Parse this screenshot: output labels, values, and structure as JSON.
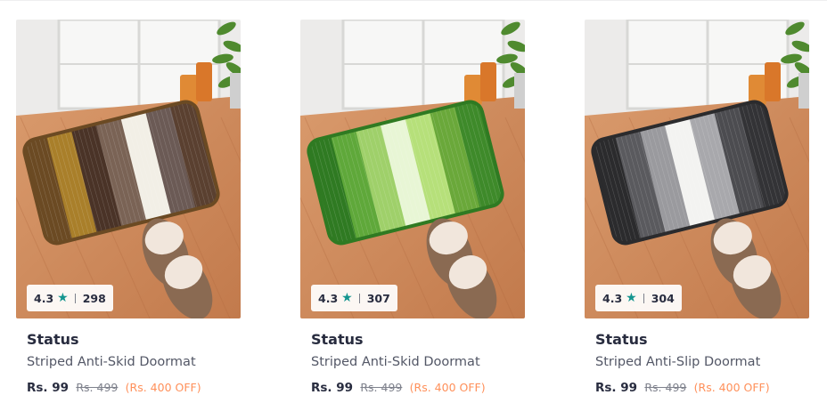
{
  "products": [
    {
      "brand": "Status",
      "name": "Striped Anti-Skid Doormat",
      "rating": "4.3",
      "reviews": "298",
      "price": "Rs. 99",
      "mrp": "Rs. 499",
      "discount": "(Rs. 400 OFF)",
      "mat_colors": [
        "#6b4a23",
        "#a97f2a",
        "#4a3327",
        "#7a6355",
        "#f2efe6",
        "#6b5a55",
        "#5a4030"
      ]
    },
    {
      "brand": "Status",
      "name": "Striped Anti-Skid Doormat",
      "rating": "4.3",
      "reviews": "307",
      "price": "Rs. 99",
      "mrp": "Rs. 499",
      "discount": "(Rs. 400 OFF)",
      "mat_colors": [
        "#2f7a22",
        "#5fa83a",
        "#9fd06a",
        "#e8f6d5",
        "#b6e07a",
        "#6aa83a",
        "#3e8a2a"
      ]
    },
    {
      "brand": "Status",
      "name": "Striped Anti-Slip Doormat",
      "rating": "4.3",
      "reviews": "304",
      "price": "Rs. 99",
      "mrp": "Rs. 499",
      "discount": "(Rs. 400 OFF)",
      "mat_colors": [
        "#2b2b2d",
        "#5a5a5e",
        "#9a9a9e",
        "#f3f3f1",
        "#a8a8ac",
        "#4c4c50",
        "#333336"
      ]
    }
  ],
  "colors": {
    "accent_star": "#14958f",
    "discount": "#ff905a",
    "text_primary": "#282c3f",
    "text_secondary": "#535766",
    "text_muted": "#7e818c"
  },
  "icons": {
    "rating": "star-icon"
  }
}
